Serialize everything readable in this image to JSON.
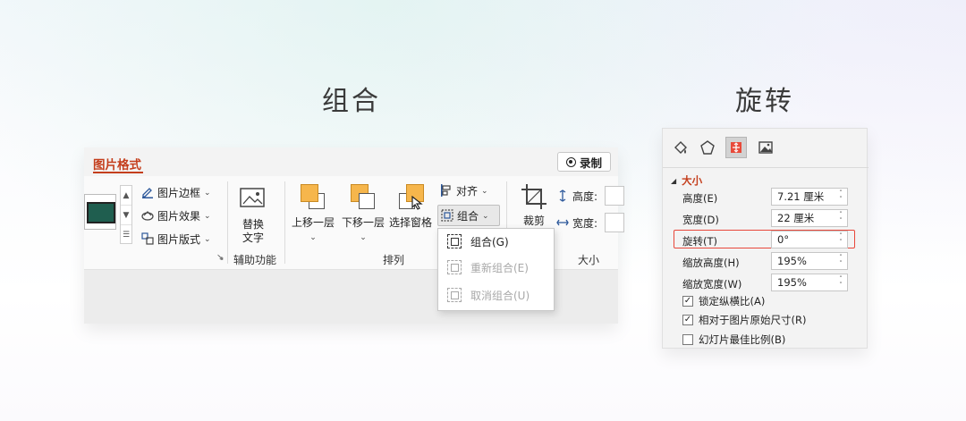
{
  "titles": {
    "group": "组合",
    "rotate": "旋转"
  },
  "ribbon": {
    "tab_active": "图片格式",
    "record_label": "录制",
    "picture_menu": [
      "图片边框",
      "图片效果",
      "图片版式"
    ],
    "alt_text": {
      "line1": "替换",
      "line2": "文字"
    },
    "accessibility_group_label": "辅助功能",
    "arrange": {
      "bring_forward": "上移一层",
      "send_backward": "下移一层",
      "selection_pane": "选择窗格",
      "align": "对齐",
      "group": "组合",
      "group_label": "排列"
    },
    "crop_label": "裁剪",
    "height_label": "高度:",
    "width_label": "宽度:",
    "size_group_label": "大小"
  },
  "group_dropdown": {
    "items": [
      {
        "label": "组合(G)",
        "enabled": true
      },
      {
        "label": "重新组合(E)",
        "enabled": false
      },
      {
        "label": "取消组合(U)",
        "enabled": false
      }
    ]
  },
  "format_pane": {
    "icons": [
      "fill-line-icon",
      "effects-icon",
      "size-properties-icon",
      "picture-icon"
    ],
    "section_title": "大小",
    "fields": [
      {
        "label": "高度(E)",
        "value": "7.21 厘米"
      },
      {
        "label": "宽度(D)",
        "value": "22 厘米"
      },
      {
        "label": "旋转(T)",
        "value": "0°"
      },
      {
        "label": "缩放高度(H)",
        "value": "195%"
      },
      {
        "label": "缩放宽度(W)",
        "value": "195%"
      }
    ],
    "checkboxes": [
      {
        "label": "锁定纵横比(A)",
        "checked": true
      },
      {
        "label": "相对于图片原始尺寸(R)",
        "checked": true
      },
      {
        "label": "幻灯片最佳比例(B)",
        "checked": false
      }
    ],
    "highlight_color": "#e8473a",
    "accent_color": "#c43e1c"
  }
}
